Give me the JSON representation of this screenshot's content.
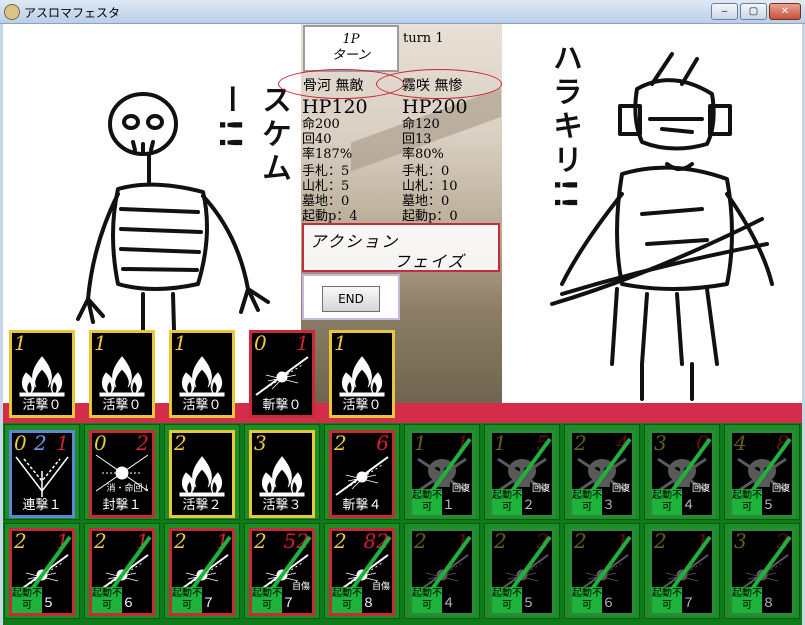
{
  "window": {
    "title": "アスロマフェスタ",
    "min_glyph": "‒",
    "max_glyph": "▢",
    "close_glyph": "✕"
  },
  "turn": {
    "player_line1": "1P",
    "player_line2": "ターン",
    "label": "turn 1"
  },
  "players": [
    {
      "name": "骨河 無敵",
      "hp": "HP120",
      "hit": "命200",
      "evade": "回40",
      "rate": "率187%",
      "hand": "手札：5",
      "deck": "山札：5",
      "grave": "墓地：0",
      "boot": "起動p：4"
    },
    {
      "name": "霧咲 無惨",
      "hp": "HP200",
      "hit": "命120",
      "evade": "回13",
      "rate": "率80%",
      "hand": "手札：0",
      "deck": "山札：10",
      "grave": "墓地：0",
      "boot": "起動p：0"
    }
  ],
  "phase": {
    "line1": "アクション",
    "line2": "フェイズ"
  },
  "end_button": "END",
  "doodle_text": {
    "left": "スケムー!!",
    "right": "ハラキリ!!"
  },
  "hand_cards": [
    {
      "cost": "1",
      "name": "活撃０",
      "art": "flame"
    },
    {
      "cost": "1",
      "name": "活撃０",
      "art": "flame"
    },
    {
      "cost": "1",
      "name": "活撃０",
      "art": "flame"
    },
    {
      "cost": "0",
      "extra": "1",
      "name": "斬撃０",
      "art": "slash"
    },
    {
      "cost": "1",
      "name": "活撃０",
      "art": "flame"
    }
  ],
  "row1_cards": [
    {
      "cost": "0",
      "mid": "2",
      "extra": "1",
      "name": "連撃１",
      "art": "chain",
      "frame": "blue"
    },
    {
      "cost": "0",
      "extra": "2",
      "name": "封撃１",
      "art": "seal",
      "frame": "red",
      "note": "消・命回↓"
    },
    {
      "cost": "2",
      "name": "活撃２",
      "art": "flame",
      "frame": "gold"
    },
    {
      "cost": "3",
      "name": "活撃３",
      "art": "flame",
      "frame": "gold"
    },
    {
      "cost": "2",
      "extra": "6",
      "name": "斬撃４",
      "art": "slash",
      "frame": "red"
    },
    {
      "cost": "1",
      "extra": "1",
      "name": "撃１",
      "art": "skull",
      "frame": "dim",
      "note": "回復"
    },
    {
      "cost": "1",
      "extra": "5",
      "name": "撃２",
      "art": "skull",
      "frame": "dim",
      "note": "回復"
    },
    {
      "cost": "2",
      "extra": "4",
      "name": "撃３",
      "art": "skull",
      "frame": "dim",
      "note": "回復"
    },
    {
      "cost": "3",
      "extra": "0",
      "name": "撃４",
      "art": "skull",
      "frame": "dim",
      "note": "回復"
    },
    {
      "cost": "4",
      "extra": "8",
      "name": "撃５",
      "art": "skull",
      "frame": "dim",
      "note": "回復"
    }
  ],
  "row2_cards": [
    {
      "cost": "2",
      "extra": "1",
      "name": "撃５",
      "art": "slash"
    },
    {
      "cost": "2",
      "extra": "1",
      "name": "撃６",
      "art": "slash"
    },
    {
      "cost": "2",
      "extra": "1",
      "name": "撃７",
      "art": "slash"
    },
    {
      "cost": "2",
      "extra": "52",
      "name": "撃７",
      "art": "slash",
      "note": "自傷"
    },
    {
      "cost": "2",
      "extra": "82",
      "name": "撃８",
      "art": "slash",
      "note": "自傷"
    },
    {
      "cost": "2",
      "extra": "1",
      "name": "撃４",
      "art": "slash"
    },
    {
      "cost": "2",
      "extra": "2",
      "name": "撃５",
      "art": "slash"
    },
    {
      "cost": "2",
      "extra": "1",
      "name": "撃６",
      "art": "slash"
    },
    {
      "cost": "2",
      "extra": "1",
      "name": "撃７",
      "art": "slash"
    },
    {
      "cost": "3",
      "extra": "2",
      "name": "撃８",
      "art": "slash"
    }
  ],
  "disabled_badge": "起動不可",
  "colors": {
    "card_gold": "#e6c63a",
    "card_red": "#c92a3a",
    "card_blue": "#5f86d6",
    "board_green": "#0f7a1a",
    "band_red": "#d42c4a"
  }
}
